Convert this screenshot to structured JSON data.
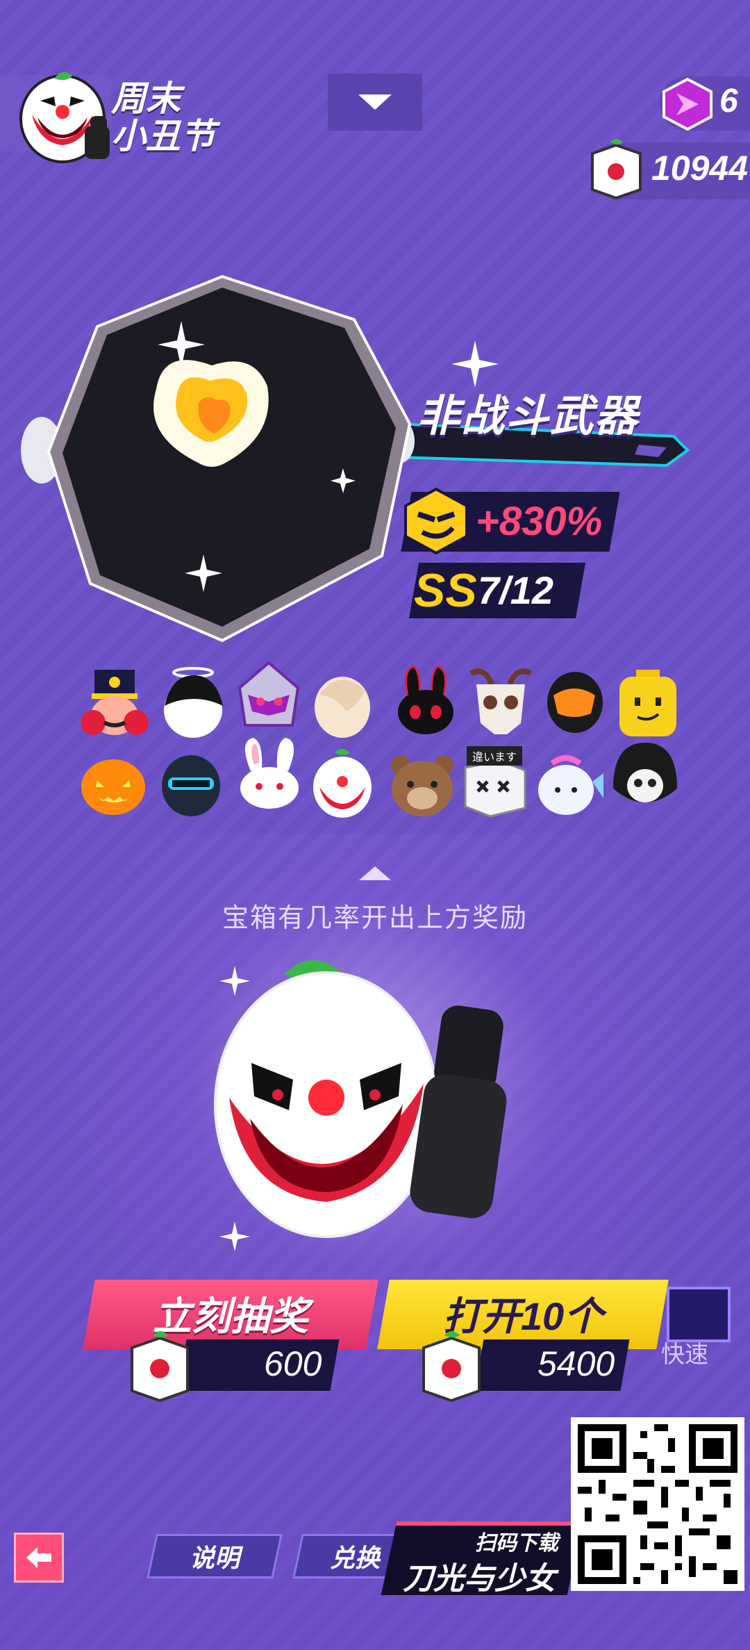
{
  "event": {
    "title_line1": "周末",
    "title_line2": "小丑节"
  },
  "currency": {
    "gems": "6",
    "coins": "10944"
  },
  "weapon": {
    "title": "非战斗武器",
    "bonus": "+830%",
    "rank": "SS",
    "progress": "7/12"
  },
  "rewards": {
    "hint": "宝箱有几率开出上方奖励",
    "items": [
      {
        "icon": "nutcracker-head-icon"
      },
      {
        "icon": "angel-hair-head-icon"
      },
      {
        "icon": "armored-rider-head-icon"
      },
      {
        "icon": "blonde-hair-head-icon"
      },
      {
        "icon": "black-bunny-head-icon"
      },
      {
        "icon": "skull-horn-head-icon"
      },
      {
        "icon": "black-visor-head-icon"
      },
      {
        "icon": "yellow-block-head-icon"
      },
      {
        "icon": "pumpkin-head-icon"
      },
      {
        "icon": "knight-helmet-head-icon"
      },
      {
        "icon": "white-bunny-head-icon"
      },
      {
        "icon": "clown-head-icon"
      },
      {
        "icon": "bear-head-icon"
      },
      {
        "icon": "box-head-icon"
      },
      {
        "icon": "fish-head-icon"
      },
      {
        "icon": "reaper-head-icon"
      }
    ],
    "box_tag": "違います"
  },
  "actions": {
    "draw_label": "立刻抽奖",
    "draw_price": "600",
    "ten_label": "打开10个",
    "ten_price": "5400",
    "fast_label": "快速"
  },
  "bottom": {
    "help_label": "说明",
    "exchange_label": "兑换",
    "promo_sub": "扫码下载",
    "promo_main": "刀光与少女"
  },
  "colors": {
    "background": "#6f55c9",
    "draw_button": "#ff5a86",
    "ten_button": "#ffe63a",
    "bonus_text": "#ff4a7a",
    "rank_text": "#ffd21c"
  }
}
